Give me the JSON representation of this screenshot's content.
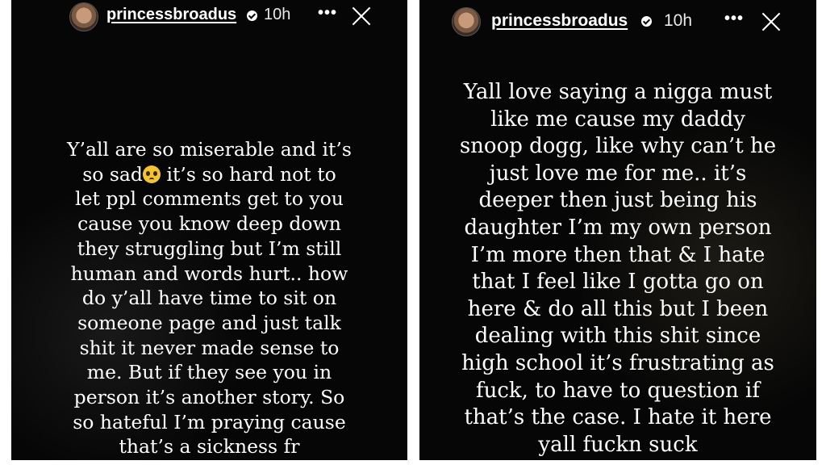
{
  "stories": [
    {
      "username": "princessbroadus",
      "time": "10h",
      "more_icon": "•••",
      "lines": [
        "Y’all are so miserable and it’s",
        "so sad",
        "it’s so hard not to",
        "let ppl comments get to you",
        "cause you know deep down",
        "they struggling but I’m still",
        "human and words hurt.. how",
        "do y’all have time to sit on",
        "someone page and just talk",
        "shit it never made sense to",
        "me. But if they see you in",
        "person it’s another story. So",
        "so hateful I’m praying cause",
        "that’s a sickness fr"
      ],
      "emoji": "pleading-face-emoji"
    },
    {
      "username": "princessbroadus",
      "time": "10h",
      "more_icon": "•••",
      "lines": [
        "Yall love saying a nigga must",
        "like me cause my daddy",
        "snoop dogg, like why can’t he",
        "just love me for me.. it’s",
        "deeper then just being his",
        "daughter I’m my own person",
        "I’m more then that & I hate",
        "that I feel like I gotta go on",
        "here & do all this but I been",
        "dealing with this shit since",
        "high school it’s frustrating as",
        "fuck, to have to question if",
        "that’s the case. I hate it here",
        "yall fuckn suck"
      ]
    }
  ],
  "colors": {
    "background": "#060606",
    "text": "#ffffff",
    "emoji": "#f4c330"
  }
}
